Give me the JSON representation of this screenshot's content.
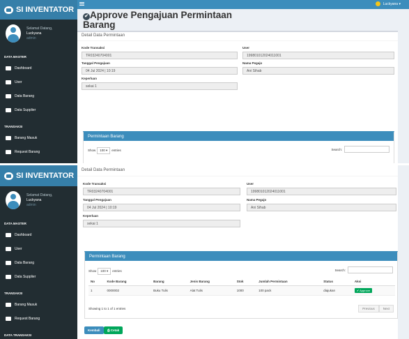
{
  "app": {
    "brand": "SI INVENTATOR"
  },
  "user": {
    "greeting": "Selamat Datang,",
    "name": "Luckyana",
    "role": "admin",
    "top_name": "Luckyana ▾"
  },
  "sidebar": {
    "section_master": "DATA MASTER",
    "section_transaksi": "TRANSAKSI",
    "section_transaksi2": "DATA TRANSAKSI",
    "items": [
      {
        "label": "Dashboard",
        "icon": "dashboard-icon"
      },
      {
        "label": "User",
        "icon": "users-icon"
      },
      {
        "label": "Data Barang",
        "icon": "box-icon"
      },
      {
        "label": "Data Supplier",
        "icon": "truck-icon"
      },
      {
        "label": "Barang Masuk",
        "icon": "table-icon"
      },
      {
        "label": "Request Barang",
        "icon": "clock-icon"
      }
    ]
  },
  "page": {
    "title_line1": "Approve Pengajuan Permintaan",
    "title_line2": "Barang",
    "check_icon": "✔"
  },
  "detail": {
    "header": "Detail Data Permintaan",
    "kode_label": "Kode Transaksi",
    "kode_value": "TR03240704001",
    "user_label": "User",
    "user_value": "199801012024011001",
    "tanggal_label": "Tanggal Pengajuan",
    "tanggal_value": "04 Jul 2024 | 10:19",
    "pegawai_label": "Nama Pegajo",
    "pegawai_value": "Ani Sihab",
    "keperluan_label": "Keperluan",
    "keperluan_value": "sekai 1"
  },
  "permintaan": {
    "header": "Permintaan Barang",
    "show_label": "Show",
    "show_value": "100",
    "entries_label": "entries",
    "search_label": "Search:",
    "columns": [
      "No",
      "Kode Barang",
      "Barang",
      "Jenis Barang",
      "Stok",
      "Jumlah Permintaan",
      "Status",
      "Aksi"
    ],
    "rows": [
      {
        "no": "1",
        "kode": "0000002",
        "barang": "Buku Tulis",
        "jenis": "Alat Tulis",
        "stok": "1000",
        "jumlah": "100 pack",
        "status": "diajukan",
        "aksi": "Approve"
      }
    ],
    "info": "Showing 1 to 1 of 1 entries",
    "prev": "Previous",
    "next": "Next"
  },
  "buttons": {
    "kembali": "Kembali",
    "cetak": "Cetak"
  },
  "colors": {
    "primary": "#3c8dbc",
    "sidebar": "#222d32",
    "brand": "#367fa9",
    "success": "#00a65a"
  }
}
